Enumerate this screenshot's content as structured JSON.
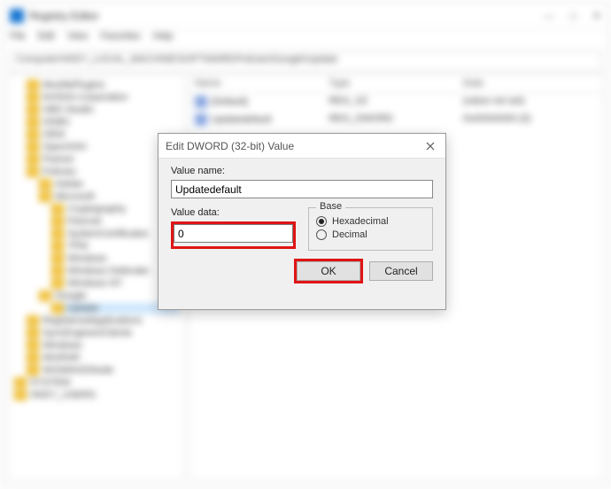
{
  "window": {
    "title": "Registry Editor",
    "menu": [
      "File",
      "Edit",
      "View",
      "Favorites",
      "Help"
    ],
    "address": "Computer\\HKEY_LOCAL_MACHINE\\SOFTWARE\\Policies\\Google\\Update",
    "win_min": "—",
    "win_max": "□",
    "win_close": "✕"
  },
  "tree": {
    "items": [
      {
        "label": "MozillaPlugins",
        "cls": "ind1"
      },
      {
        "label": "NVIDIA Corporation",
        "cls": "ind1"
      },
      {
        "label": "OBS Studio",
        "cls": "ind1"
      },
      {
        "label": "ODBC",
        "cls": "ind1"
      },
      {
        "label": "OEM",
        "cls": "ind1"
      },
      {
        "label": "OpenSSH",
        "cls": "ind1"
      },
      {
        "label": "Partner",
        "cls": "ind1"
      },
      {
        "label": "Policies",
        "cls": "ind1"
      },
      {
        "label": "Adobe",
        "cls": "ind2"
      },
      {
        "label": "Microsoft",
        "cls": "ind2"
      },
      {
        "label": "Cryptography",
        "cls": "ind3"
      },
      {
        "label": "Peernet",
        "cls": "ind3"
      },
      {
        "label": "SystemCertificates",
        "cls": "ind3"
      },
      {
        "label": "TPM",
        "cls": "ind3"
      },
      {
        "label": "Windows",
        "cls": "ind3"
      },
      {
        "label": "Windows Defender",
        "cls": "ind3"
      },
      {
        "label": "Windows NT",
        "cls": "ind3"
      },
      {
        "label": "Google",
        "cls": "ind2"
      },
      {
        "label": "Update",
        "cls": "ind3 sel"
      },
      {
        "label": "RegisteredApplications",
        "cls": "ind1"
      },
      {
        "label": "SyncEngines\\Clients",
        "cls": "ind1"
      },
      {
        "label": "Windows",
        "cls": "ind1"
      },
      {
        "label": "WinRAR",
        "cls": "ind1"
      },
      {
        "label": "WOW6432Node",
        "cls": "ind1"
      },
      {
        "label": "SYSTEM",
        "cls": ""
      },
      {
        "label": "HKEY_USERS",
        "cls": ""
      }
    ]
  },
  "list": {
    "headers": [
      "Name",
      "Type",
      "Data"
    ],
    "rows": [
      {
        "name": "(Default)",
        "type": "REG_SZ",
        "data": "(value not set)"
      },
      {
        "name": "Updatedefault",
        "type": "REG_DWORD",
        "data": "0x00000000 (0)"
      }
    ]
  },
  "dialog": {
    "title": "Edit DWORD (32-bit) Value",
    "value_name_label": "Value name:",
    "value_name": "Updatedefault",
    "value_data_label": "Value data:",
    "value_data": "0",
    "base_legend": "Base",
    "radio_hex": "Hexadecimal",
    "radio_dec": "Decimal",
    "base_selected": "hex",
    "ok": "OK",
    "cancel": "Cancel"
  }
}
